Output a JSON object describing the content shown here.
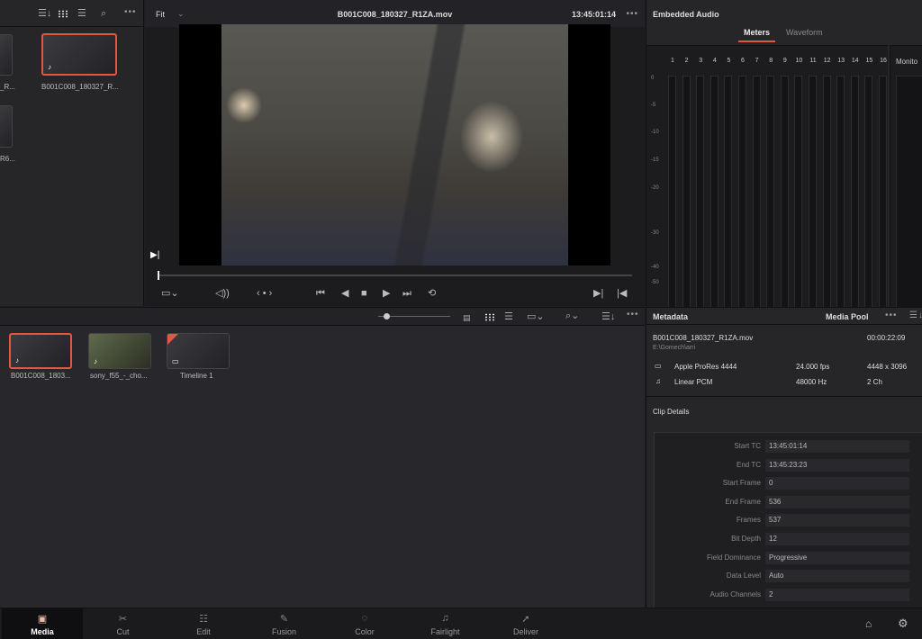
{
  "storage": {
    "clips": [
      {
        "label": "_R..."
      },
      {
        "label": "B001C008_180327_R..."
      },
      {
        "label": "R6..."
      }
    ]
  },
  "viewer": {
    "zoom": "Fit",
    "title": "B001C008_180327_R1ZA.mov",
    "timecode": "13:45:01:14",
    "playhead": 0.0
  },
  "audio": {
    "title": "Embedded Audio",
    "tabs": [
      "Meters",
      "Waveform"
    ],
    "active_tab": "Meters",
    "channels": [
      "1",
      "2",
      "3",
      "4",
      "5",
      "6",
      "7",
      "8",
      "9",
      "10",
      "11",
      "12",
      "13",
      "14",
      "15",
      "16"
    ],
    "scale": [
      "0",
      "-5",
      "-10",
      "-15",
      "-20",
      "-30",
      "-40",
      "-50"
    ],
    "monitor_label": "Monito"
  },
  "pool": {
    "clips": [
      {
        "label": "B001C008_1803...",
        "selected": true
      },
      {
        "label": "sony_f55_-_cho...",
        "selected": false
      },
      {
        "label": "Timeline 1",
        "selected": false
      }
    ]
  },
  "metadata": {
    "title": "Metadata",
    "section": "Media Pool",
    "clip_name": "B001C008_180327_R1ZA.mov",
    "duration": "00:00:22:09",
    "path": "E:\\Gomech\\arri",
    "video_codec": "Apple ProRes 4444",
    "fps": "24.000 fps",
    "resolution": "4448 x 3096",
    "audio_codec": "Linear PCM",
    "sample_rate": "48000 Hz",
    "audio_channels": "2 Ch",
    "details_title": "Clip Details",
    "details": [
      {
        "label": "Start TC",
        "value": "13:45:01:14"
      },
      {
        "label": "End TC",
        "value": "13:45:23:23"
      },
      {
        "label": "Start Frame",
        "value": "0"
      },
      {
        "label": "End Frame",
        "value": "536"
      },
      {
        "label": "Frames",
        "value": "537"
      },
      {
        "label": "Bit Depth",
        "value": "12"
      },
      {
        "label": "Field Dominance",
        "value": "Progressive"
      },
      {
        "label": "Data Level",
        "value": "Auto"
      },
      {
        "label": "Audio Channels",
        "value": "2"
      }
    ]
  },
  "pages": [
    {
      "label": "Media",
      "icon": "media-icon"
    },
    {
      "label": "Cut",
      "icon": "cut-icon"
    },
    {
      "label": "Edit",
      "icon": "edit-icon"
    },
    {
      "label": "Fusion",
      "icon": "fusion-icon"
    },
    {
      "label": "Color",
      "icon": "color-icon"
    },
    {
      "label": "Fairlight",
      "icon": "fairlight-icon"
    },
    {
      "label": "Deliver",
      "icon": "deliver-icon"
    }
  ],
  "active_page": "Media",
  "colors": {
    "accent": "#e25744",
    "background": "#1e1e22"
  }
}
